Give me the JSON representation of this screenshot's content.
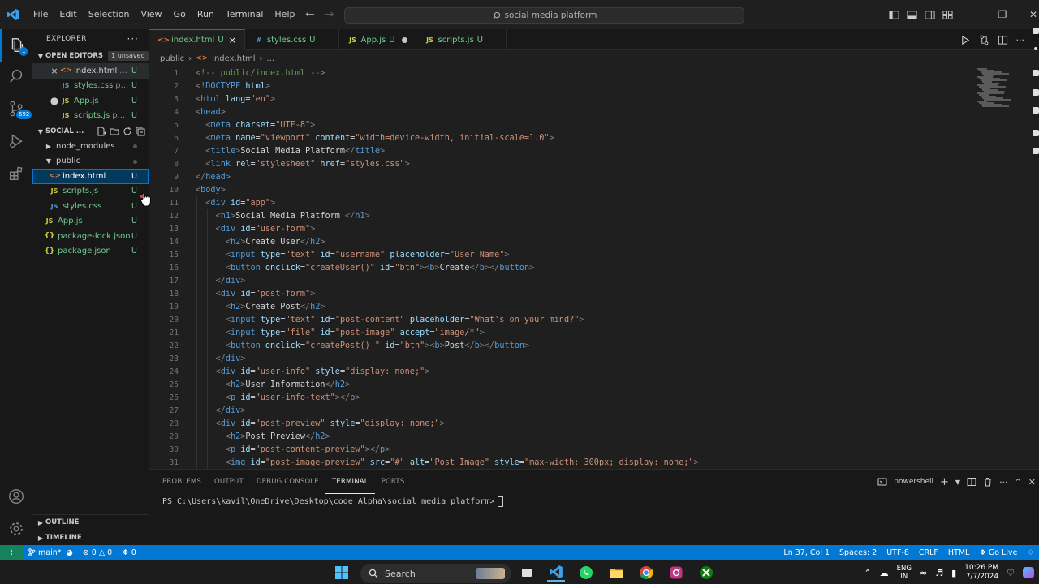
{
  "menubar": [
    "File",
    "Edit",
    "Selection",
    "View",
    "Go",
    "Run",
    "Terminal",
    "Help"
  ],
  "command_center": "social media platform",
  "explorer": {
    "title": "EXPLORER",
    "open_editors": {
      "label": "OPEN EDITORS",
      "badge": "1 unsaved",
      "items": [
        {
          "icon": "<>",
          "kind": "html",
          "name": "index.html",
          "extra": "...",
          "status": "U",
          "lead": "close"
        },
        {
          "icon": "JS",
          "kind": "css",
          "name": "styles.css",
          "extra": "p...",
          "status": "U",
          "lead": ""
        },
        {
          "icon": "JS",
          "kind": "js",
          "name": "App.js",
          "extra": "",
          "status": "U",
          "lead": "dot"
        },
        {
          "icon": "JS",
          "kind": "js",
          "name": "scripts.js",
          "extra": "p...",
          "status": "U",
          "lead": ""
        }
      ]
    },
    "workspace": {
      "label": "SOCIAL ...",
      "items": [
        {
          "name": "node_modules",
          "type": "folder",
          "depth": 1,
          "status": "dot"
        },
        {
          "name": "public",
          "type": "folder-open",
          "depth": 1,
          "status": "dot"
        },
        {
          "name": "index.html",
          "type": "html",
          "depth": 2,
          "status": "U",
          "selected": true
        },
        {
          "name": "scripts.js",
          "type": "js",
          "depth": 2,
          "status": "U"
        },
        {
          "name": "styles.css",
          "type": "css",
          "depth": 2,
          "status": "U"
        },
        {
          "name": "App.js",
          "type": "js",
          "depth": 1,
          "status": "U"
        },
        {
          "name": "package-lock.json",
          "type": "json",
          "depth": 1,
          "status": "U"
        },
        {
          "name": "package.json",
          "type": "json",
          "depth": 1,
          "status": "U"
        }
      ]
    },
    "outline": "OUTLINE",
    "timeline": "TIMELINE"
  },
  "activity_badge": "692",
  "tabs": [
    {
      "icon": "<>",
      "name": "index.html",
      "status": "U",
      "active": true,
      "after": "close"
    },
    {
      "icon": "#",
      "name": "styles.css",
      "status": "U",
      "active": false,
      "after": ""
    },
    {
      "icon": "JS",
      "name": "App.js",
      "status": "U",
      "active": false,
      "after": "dot"
    },
    {
      "icon": "JS",
      "name": "scripts.js",
      "status": "U",
      "active": false,
      "after": ""
    }
  ],
  "breadcrumb": {
    "folder": "public",
    "icon": "<>",
    "file": "index.html",
    "tail": "..."
  },
  "code": [
    [
      [
        "c",
        "<!-- public/index.html -->"
      ]
    ],
    [
      [
        "p",
        "<!"
      ],
      [
        "t",
        "DOCTYPE"
      ],
      [
        "x",
        " "
      ],
      [
        "a",
        "html"
      ],
      [
        "p",
        ">"
      ]
    ],
    [
      [
        "p",
        "<"
      ],
      [
        "t",
        "html"
      ],
      [
        "x",
        " "
      ],
      [
        "a",
        "lang"
      ],
      [
        "x",
        "="
      ],
      [
        "s",
        "\"en\""
      ],
      [
        "p",
        ">"
      ]
    ],
    [
      [
        "p",
        "<"
      ],
      [
        "t",
        "head"
      ],
      [
        "p",
        ">"
      ]
    ],
    [
      [
        "x",
        "  "
      ],
      [
        "p",
        "<"
      ],
      [
        "t",
        "meta"
      ],
      [
        "x",
        " "
      ],
      [
        "a",
        "charset"
      ],
      [
        "x",
        "="
      ],
      [
        "s",
        "\"UTF-8\""
      ],
      [
        "p",
        ">"
      ]
    ],
    [
      [
        "x",
        "  "
      ],
      [
        "p",
        "<"
      ],
      [
        "t",
        "meta"
      ],
      [
        "x",
        " "
      ],
      [
        "a",
        "name"
      ],
      [
        "x",
        "="
      ],
      [
        "s",
        "\"viewport\""
      ],
      [
        "x",
        " "
      ],
      [
        "a",
        "content"
      ],
      [
        "x",
        "="
      ],
      [
        "s",
        "\"width=device-width, initial-scale=1.0\""
      ],
      [
        "p",
        ">"
      ]
    ],
    [
      [
        "x",
        "  "
      ],
      [
        "p",
        "<"
      ],
      [
        "t",
        "title"
      ],
      [
        "p",
        ">"
      ],
      [
        "x",
        "Social Media Platform"
      ],
      [
        "p",
        "</"
      ],
      [
        "t",
        "title"
      ],
      [
        "p",
        ">"
      ]
    ],
    [
      [
        "x",
        "  "
      ],
      [
        "p",
        "<"
      ],
      [
        "t",
        "link"
      ],
      [
        "x",
        " "
      ],
      [
        "a",
        "rel"
      ],
      [
        "x",
        "="
      ],
      [
        "s",
        "\"stylesheet\""
      ],
      [
        "x",
        " "
      ],
      [
        "a",
        "href"
      ],
      [
        "x",
        "="
      ],
      [
        "s",
        "\"styles.css\""
      ],
      [
        "p",
        ">"
      ]
    ],
    [
      [
        "p",
        "</"
      ],
      [
        "t",
        "head"
      ],
      [
        "p",
        ">"
      ]
    ],
    [
      [
        "p",
        "<"
      ],
      [
        "t",
        "body"
      ],
      [
        "p",
        ">"
      ]
    ],
    [
      [
        "x",
        "  "
      ],
      [
        "p",
        "<"
      ],
      [
        "t",
        "div"
      ],
      [
        "x",
        " "
      ],
      [
        "a",
        "id"
      ],
      [
        "x",
        "="
      ],
      [
        "s",
        "\"app\""
      ],
      [
        "p",
        ">"
      ]
    ],
    [
      [
        "x",
        "    "
      ],
      [
        "p",
        "<"
      ],
      [
        "t",
        "h1"
      ],
      [
        "p",
        ">"
      ],
      [
        "x",
        "Social Media Platform "
      ],
      [
        "p",
        "</"
      ],
      [
        "t",
        "h1"
      ],
      [
        "p",
        ">"
      ]
    ],
    [
      [
        "x",
        "    "
      ],
      [
        "p",
        "<"
      ],
      [
        "t",
        "div"
      ],
      [
        "x",
        " "
      ],
      [
        "a",
        "id"
      ],
      [
        "x",
        "="
      ],
      [
        "s",
        "\"user-form\""
      ],
      [
        "p",
        ">"
      ]
    ],
    [
      [
        "x",
        "      "
      ],
      [
        "p",
        "<"
      ],
      [
        "t",
        "h2"
      ],
      [
        "p",
        ">"
      ],
      [
        "x",
        "Create User"
      ],
      [
        "p",
        "</"
      ],
      [
        "t",
        "h2"
      ],
      [
        "p",
        ">"
      ]
    ],
    [
      [
        "x",
        "      "
      ],
      [
        "p",
        "<"
      ],
      [
        "t",
        "input"
      ],
      [
        "x",
        " "
      ],
      [
        "a",
        "type"
      ],
      [
        "x",
        "="
      ],
      [
        "s",
        "\"text\""
      ],
      [
        "x",
        " "
      ],
      [
        "a",
        "id"
      ],
      [
        "x",
        "="
      ],
      [
        "s",
        "\"username\""
      ],
      [
        "x",
        " "
      ],
      [
        "a",
        "placeholder"
      ],
      [
        "x",
        "="
      ],
      [
        "s",
        "\"User Name\""
      ],
      [
        "p",
        ">"
      ]
    ],
    [
      [
        "x",
        "      "
      ],
      [
        "p",
        "<"
      ],
      [
        "t",
        "button"
      ],
      [
        "x",
        " "
      ],
      [
        "a",
        "onclick"
      ],
      [
        "x",
        "="
      ],
      [
        "s",
        "\"createUser()\""
      ],
      [
        "x",
        " "
      ],
      [
        "a",
        "id"
      ],
      [
        "x",
        "="
      ],
      [
        "s",
        "\"btn\""
      ],
      [
        "p",
        ">"
      ],
      [
        "p",
        "<"
      ],
      [
        "t",
        "b"
      ],
      [
        "p",
        ">"
      ],
      [
        "x",
        "Create"
      ],
      [
        "p",
        "</"
      ],
      [
        "t",
        "b"
      ],
      [
        "p",
        ">"
      ],
      [
        "p",
        "</"
      ],
      [
        "t",
        "button"
      ],
      [
        "p",
        ">"
      ]
    ],
    [
      [
        "x",
        "    "
      ],
      [
        "p",
        "</"
      ],
      [
        "t",
        "div"
      ],
      [
        "p",
        ">"
      ]
    ],
    [
      [
        "x",
        "    "
      ],
      [
        "p",
        "<"
      ],
      [
        "t",
        "div"
      ],
      [
        "x",
        " "
      ],
      [
        "a",
        "id"
      ],
      [
        "x",
        "="
      ],
      [
        "s",
        "\"post-form\""
      ],
      [
        "p",
        ">"
      ]
    ],
    [
      [
        "x",
        "      "
      ],
      [
        "p",
        "<"
      ],
      [
        "t",
        "h2"
      ],
      [
        "p",
        ">"
      ],
      [
        "x",
        "Create Post"
      ],
      [
        "p",
        "</"
      ],
      [
        "t",
        "h2"
      ],
      [
        "p",
        ">"
      ]
    ],
    [
      [
        "x",
        "      "
      ],
      [
        "p",
        "<"
      ],
      [
        "t",
        "input"
      ],
      [
        "x",
        " "
      ],
      [
        "a",
        "type"
      ],
      [
        "x",
        "="
      ],
      [
        "s",
        "\"text\""
      ],
      [
        "x",
        " "
      ],
      [
        "a",
        "id"
      ],
      [
        "x",
        "="
      ],
      [
        "s",
        "\"post-content\""
      ],
      [
        "x",
        " "
      ],
      [
        "a",
        "placeholder"
      ],
      [
        "x",
        "="
      ],
      [
        "s",
        "\"What's on your mind?\""
      ],
      [
        "p",
        ">"
      ]
    ],
    [
      [
        "x",
        "      "
      ],
      [
        "p",
        "<"
      ],
      [
        "t",
        "input"
      ],
      [
        "x",
        " "
      ],
      [
        "a",
        "type"
      ],
      [
        "x",
        "="
      ],
      [
        "s",
        "\"file\""
      ],
      [
        "x",
        " "
      ],
      [
        "a",
        "id"
      ],
      [
        "x",
        "="
      ],
      [
        "s",
        "\"post-image\""
      ],
      [
        "x",
        " "
      ],
      [
        "a",
        "accept"
      ],
      [
        "x",
        "="
      ],
      [
        "s",
        "\"image/*\""
      ],
      [
        "p",
        ">"
      ]
    ],
    [
      [
        "x",
        "      "
      ],
      [
        "p",
        "<"
      ],
      [
        "t",
        "button"
      ],
      [
        "x",
        " "
      ],
      [
        "a",
        "onclick"
      ],
      [
        "x",
        "="
      ],
      [
        "s",
        "\"createPost() \""
      ],
      [
        "x",
        " "
      ],
      [
        "a",
        "id"
      ],
      [
        "x",
        "="
      ],
      [
        "s",
        "\"btn\""
      ],
      [
        "p",
        ">"
      ],
      [
        "p",
        "<"
      ],
      [
        "t",
        "b"
      ],
      [
        "p",
        ">"
      ],
      [
        "x",
        "Post"
      ],
      [
        "p",
        "</"
      ],
      [
        "t",
        "b"
      ],
      [
        "p",
        ">"
      ],
      [
        "p",
        "</"
      ],
      [
        "t",
        "button"
      ],
      [
        "p",
        ">"
      ]
    ],
    [
      [
        "x",
        "    "
      ],
      [
        "p",
        "</"
      ],
      [
        "t",
        "div"
      ],
      [
        "p",
        ">"
      ]
    ],
    [
      [
        "x",
        "    "
      ],
      [
        "p",
        "<"
      ],
      [
        "t",
        "div"
      ],
      [
        "x",
        " "
      ],
      [
        "a",
        "id"
      ],
      [
        "x",
        "="
      ],
      [
        "s",
        "\"user-info\""
      ],
      [
        "x",
        " "
      ],
      [
        "a",
        "style"
      ],
      [
        "x",
        "="
      ],
      [
        "s",
        "\"display: none;\""
      ],
      [
        "p",
        ">"
      ]
    ],
    [
      [
        "x",
        "      "
      ],
      [
        "p",
        "<"
      ],
      [
        "t",
        "h2"
      ],
      [
        "p",
        ">"
      ],
      [
        "x",
        "User Information"
      ],
      [
        "p",
        "</"
      ],
      [
        "t",
        "h2"
      ],
      [
        "p",
        ">"
      ]
    ],
    [
      [
        "x",
        "      "
      ],
      [
        "p",
        "<"
      ],
      [
        "t",
        "p"
      ],
      [
        "x",
        " "
      ],
      [
        "a",
        "id"
      ],
      [
        "x",
        "="
      ],
      [
        "s",
        "\"user-info-text\""
      ],
      [
        "p",
        "></"
      ],
      [
        "t",
        "p"
      ],
      [
        "p",
        ">"
      ]
    ],
    [
      [
        "x",
        "    "
      ],
      [
        "p",
        "</"
      ],
      [
        "t",
        "div"
      ],
      [
        "p",
        ">"
      ]
    ],
    [
      [
        "x",
        "    "
      ],
      [
        "p",
        "<"
      ],
      [
        "t",
        "div"
      ],
      [
        "x",
        " "
      ],
      [
        "a",
        "id"
      ],
      [
        "x",
        "="
      ],
      [
        "s",
        "\"post-preview\""
      ],
      [
        "x",
        " "
      ],
      [
        "a",
        "style"
      ],
      [
        "x",
        "="
      ],
      [
        "s",
        "\"display: none;\""
      ],
      [
        "p",
        ">"
      ]
    ],
    [
      [
        "x",
        "      "
      ],
      [
        "p",
        "<"
      ],
      [
        "t",
        "h2"
      ],
      [
        "p",
        ">"
      ],
      [
        "x",
        "Post Preview"
      ],
      [
        "p",
        "</"
      ],
      [
        "t",
        "h2"
      ],
      [
        "p",
        ">"
      ]
    ],
    [
      [
        "x",
        "      "
      ],
      [
        "p",
        "<"
      ],
      [
        "t",
        "p"
      ],
      [
        "x",
        " "
      ],
      [
        "a",
        "id"
      ],
      [
        "x",
        "="
      ],
      [
        "s",
        "\"post-content-preview\""
      ],
      [
        "p",
        "></"
      ],
      [
        "t",
        "p"
      ],
      [
        "p",
        ">"
      ]
    ],
    [
      [
        "x",
        "      "
      ],
      [
        "p",
        "<"
      ],
      [
        "t",
        "img"
      ],
      [
        "x",
        " "
      ],
      [
        "a",
        "id"
      ],
      [
        "x",
        "="
      ],
      [
        "s",
        "\"post-image-preview\""
      ],
      [
        "x",
        " "
      ],
      [
        "a",
        "src"
      ],
      [
        "x",
        "="
      ],
      [
        "s",
        "\"#\""
      ],
      [
        "x",
        " "
      ],
      [
        "a",
        "alt"
      ],
      [
        "x",
        "="
      ],
      [
        "s",
        "\"Post Image\""
      ],
      [
        "x",
        " "
      ],
      [
        "a",
        "style"
      ],
      [
        "x",
        "="
      ],
      [
        "s",
        "\"max-width: 300px; display: none;\""
      ],
      [
        "p",
        ">"
      ]
    ]
  ],
  "panel": {
    "tabs": [
      "PROBLEMS",
      "OUTPUT",
      "DEBUG CONSOLE",
      "TERMINAL",
      "PORTS"
    ],
    "active_tab": "TERMINAL",
    "shell": "powershell",
    "prompt": "PS C:\\Users\\kavil\\OneDrive\\Desktop\\code Alpha\\social media platform> "
  },
  "status": {
    "branch": "main*",
    "errors": "0",
    "warnings": "0",
    "ports": "0",
    "position": "Ln 37, Col 1",
    "spaces": "Spaces: 2",
    "encoding": "UTF-8",
    "eol": "CRLF",
    "language": "HTML",
    "golive": "Go Live"
  },
  "taskbar": {
    "search": "Search",
    "lang": "ENG",
    "lang_sub": "IN",
    "time": "10:26 PM",
    "date": "7/7/2024"
  },
  "colors": {
    "accent": "#0078d4",
    "untracked": "#73c991",
    "remote": "#16825d"
  }
}
